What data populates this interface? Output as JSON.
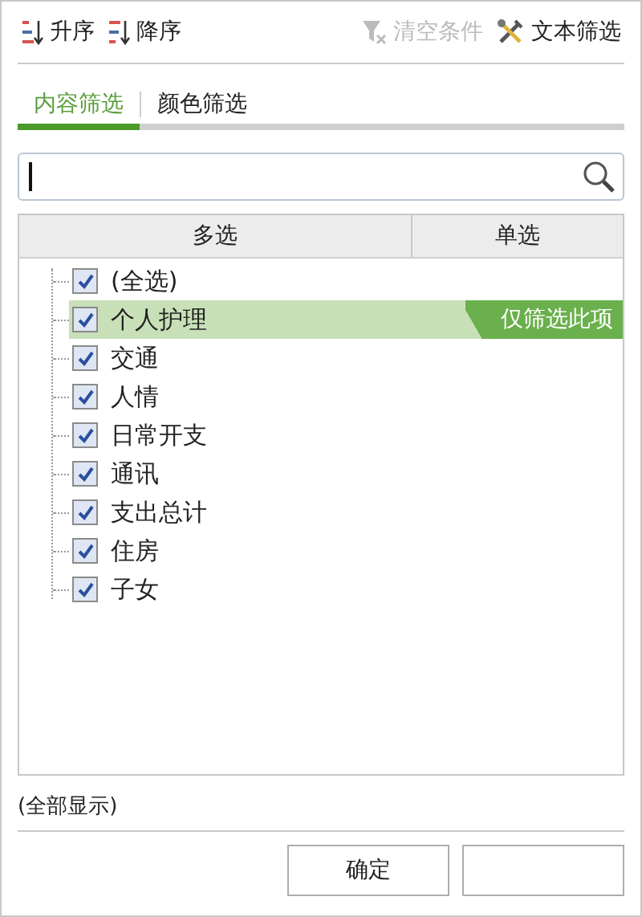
{
  "toolbar": [
    {
      "kind": "sort_asc",
      "label": "升序",
      "disabled": false
    },
    {
      "kind": "sort_desc",
      "label": "降序",
      "disabled": false
    },
    {
      "kind": "clear",
      "label": "清空条件",
      "disabled": true
    },
    {
      "kind": "text_filter",
      "label": "文本筛选",
      "disabled": false
    }
  ],
  "tabs": [
    {
      "label": "内容筛选",
      "selected": true
    },
    {
      "label": "颜色筛选",
      "selected": false
    }
  ],
  "list": {
    "columns": [
      {
        "label": "多选"
      },
      {
        "label": "单选"
      }
    ],
    "filter_only_label": "仅筛选此项",
    "items": [
      {
        "label": "(全选)",
        "checked": true,
        "selected": false
      },
      {
        "label": "个人护理",
        "checked": true,
        "selected": true
      },
      {
        "label": "交通",
        "checked": true,
        "selected": false
      },
      {
        "label": "人情",
        "checked": true,
        "selected": false
      },
      {
        "label": "日常开支",
        "checked": true,
        "selected": false
      },
      {
        "label": "通讯",
        "checked": true,
        "selected": false
      },
      {
        "label": "支出总计",
        "checked": true,
        "selected": false
      },
      {
        "label": "住房",
        "checked": true,
        "selected": false
      },
      {
        "label": "子女",
        "checked": true,
        "selected": false
      }
    ]
  },
  "status": "(全部显示)",
  "buttons": [
    {
      "kind": "labeled",
      "label": "确定"
    },
    {
      "kind": "blank"
    }
  ]
}
